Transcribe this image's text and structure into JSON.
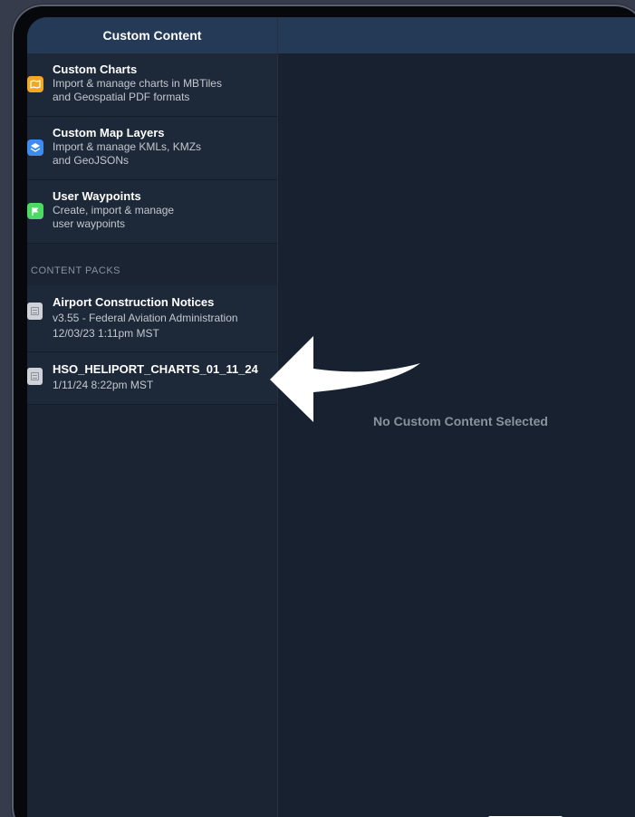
{
  "left_panel": {
    "title": "Custom Content",
    "items": [
      {
        "title": "Custom Charts",
        "sub1": "Import & manage charts in MBTiles",
        "sub2": "and Geospatial PDF formats",
        "icon": "map-book-icon",
        "color": "#f5a623"
      },
      {
        "title": "Custom Map Layers",
        "sub1": "Import & manage KMLs, KMZs",
        "sub2": "and GeoJSONs",
        "icon": "layers-icon",
        "color": "#3b8ef0"
      },
      {
        "title": "User Waypoints",
        "sub1": "Create, import & manage",
        "sub2": "user waypoints",
        "icon": "flag-icon",
        "color": "#4cd964"
      }
    ],
    "section_label": "CONTENT PACKS",
    "packs": [
      {
        "title": "Airport Construction Notices",
        "sub1": "v3.55 - Federal Aviation Administration",
        "sub2": "12/03/23 1:11pm MST"
      },
      {
        "title": "HSO_HELIPORT_CHARTS_01_11_24",
        "sub1": "1/11/24 8:22pm MST"
      }
    ]
  },
  "main": {
    "empty_message": "No Custom Content Selected"
  },
  "tab_bar": {
    "tabs": [
      {
        "icon": "home-icon",
        "glyph": "⌂"
      },
      {
        "icon": "maps-icon",
        "glyph": "⌸"
      },
      {
        "icon": "plates-icon",
        "glyph": "⎘"
      },
      {
        "icon": "documents-icon",
        "glyph": "⊟"
      },
      {
        "icon": "imagery-icon",
        "glyph": "◪"
      },
      {
        "icon": "airports-icon",
        "glyph": "✈"
      },
      {
        "icon": "custom-content-icon",
        "glyph": "⊟",
        "active": true
      },
      {
        "icon": "more-icon",
        "glyph": "≡"
      }
    ]
  }
}
